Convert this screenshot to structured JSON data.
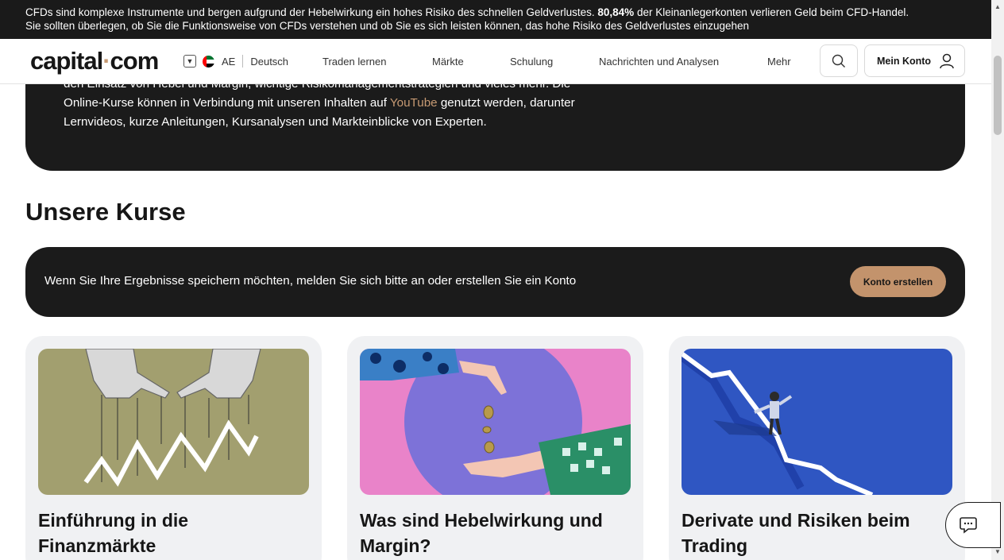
{
  "risk_warning": {
    "line1_before": "CFDs sind komplexe Instrumente und bergen aufgrund der Hebelwirkung ein hohes Risiko des schnellen Geldverlustes. ",
    "percent": "80,84%",
    "line1_after": " der Kleinanlegerkonten verlieren Geld beim CFD-Handel.",
    "line2": "Sie sollten überlegen, ob Sie die Funktionsweise von CFDs verstehen und ob Sie es sich leisten können, das hohe Risiko des Geldverlustes einzugehen"
  },
  "header": {
    "logo_left": "capital",
    "logo_dot": "·",
    "logo_right": "com",
    "region_code": "AE",
    "language": "Deutsch",
    "nav": [
      "Traden lernen",
      "Märkte",
      "Schulung",
      "Nachrichten und Analysen",
      "Mehr"
    ],
    "account_label": "Mein Konto",
    "icons": {
      "search": "search-icon",
      "account": "user-icon",
      "region": "chevron-down-icon",
      "flag": "uae-flag-icon"
    }
  },
  "hero": {
    "line1": "den Einsatz von Hebel und Margin, wichtige Risikomanagementstrategien und vieles mehr. Die",
    "line2_before": "Online-Kurse können in Verbindung mit unseren Inhalten auf ",
    "link": "YouTube",
    "line2_after": " genutzt werden, darunter",
    "line3": "Lernvideos, kurze Anleitungen, Kursanalysen und Markteinblicke von Experten."
  },
  "courses": {
    "title": "Unsere Kurse",
    "login_prompt": "Wenn Sie Ihre Ergebnisse speichern möchten, melden Sie sich bitte an oder erstellen Sie ein Konto",
    "create_account": "Konto erstellen",
    "cards": [
      {
        "title": "Einführung in die Finanzmärkte"
      },
      {
        "title": "Was sind Hebelwirkung und Margin?"
      },
      {
        "title": "Derivate und Risiken beim Trading"
      }
    ]
  },
  "colors": {
    "accent": "#c79a73",
    "dark": "#1b1b1b",
    "card_bg": "#f0f1f3"
  }
}
